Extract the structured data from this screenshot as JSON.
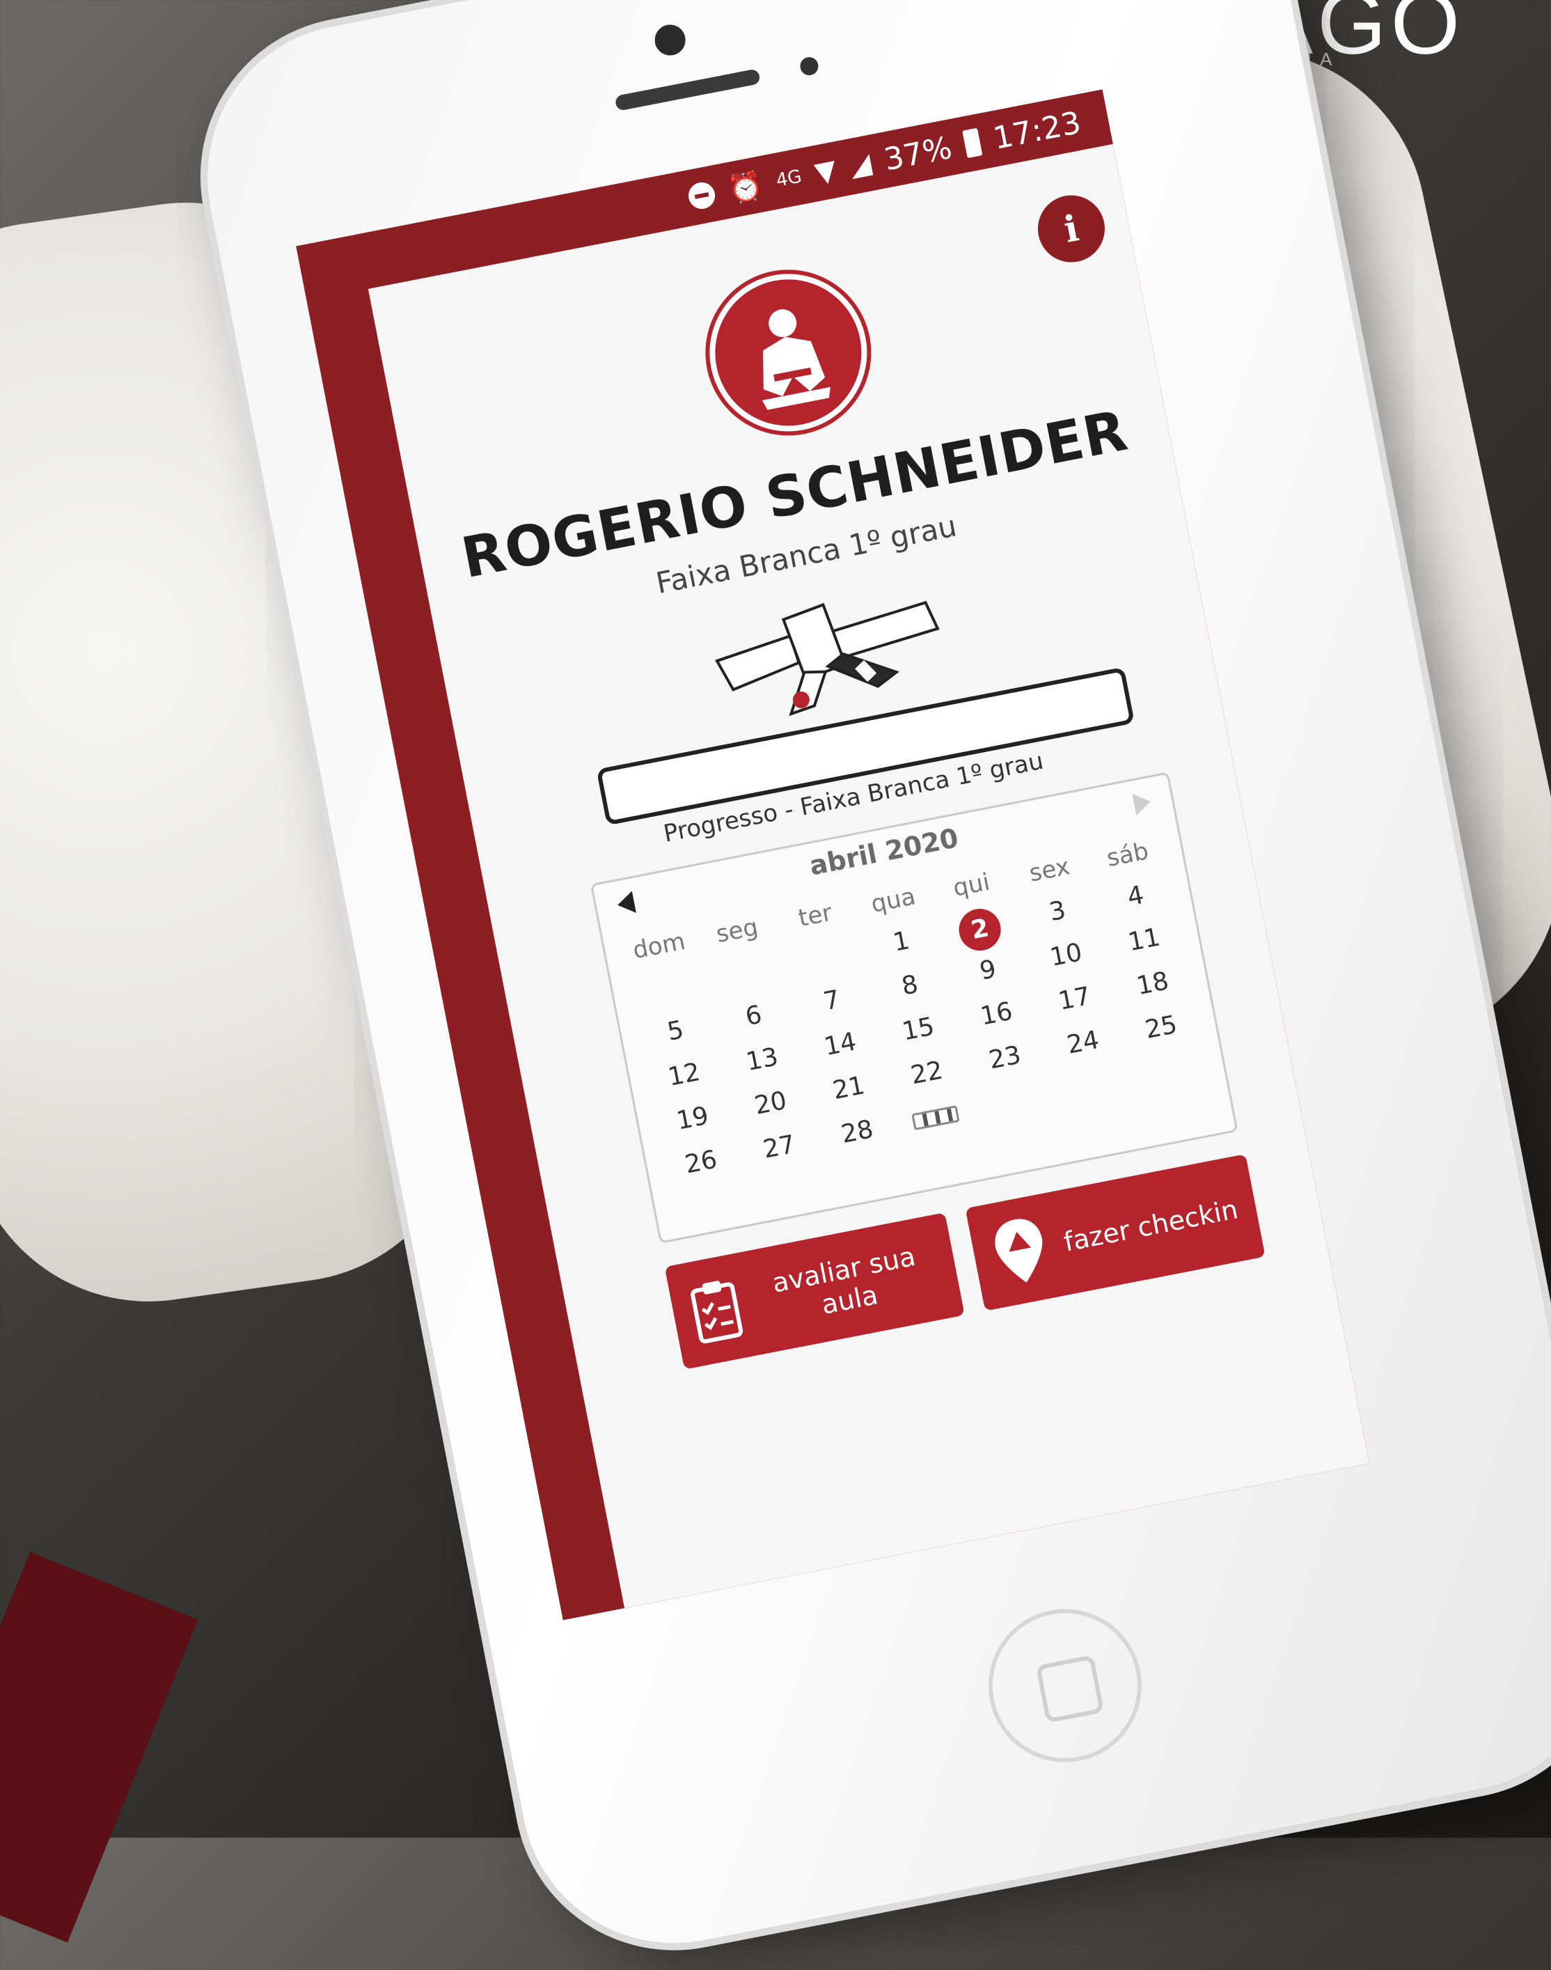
{
  "brand": {
    "name": "CARTAGO",
    "subtitle": "TECNOLOGIA"
  },
  "status_bar": {
    "battery": "37%",
    "time": "17:23",
    "network": "4G"
  },
  "profile": {
    "name": "ROGERIO SCHNEIDER",
    "rank": "Faixa Branca 1º grau",
    "progress_label": "Progresso - Faixa Branca 1º grau",
    "progress_fraction": 0
  },
  "calendar": {
    "title": "abril 2020",
    "weekdays": [
      "dom",
      "seg",
      "ter",
      "qua",
      "qui",
      "sex",
      "sáb"
    ],
    "weeks": [
      [
        "",
        "",
        "",
        "1",
        "2",
        "3",
        "4"
      ],
      [
        "5",
        "6",
        "7",
        "8",
        "9",
        "10",
        "11"
      ],
      [
        "12",
        "13",
        "14",
        "15",
        "16",
        "17",
        "18"
      ],
      [
        "19",
        "20",
        "21",
        "22",
        "23",
        "24",
        "25"
      ],
      [
        "26",
        "27",
        "28",
        "",
        "",
        "",
        ""
      ]
    ],
    "today": "2"
  },
  "actions": {
    "evaluate": "avaliar sua aula",
    "checkin": "fazer checkin"
  },
  "colors": {
    "primary": "#b5242c",
    "dark": "#8c1e24"
  },
  "icons": [
    "info-icon",
    "judoka-logo-icon",
    "belt-icon",
    "clipboard-icon",
    "location-pin-icon"
  ]
}
